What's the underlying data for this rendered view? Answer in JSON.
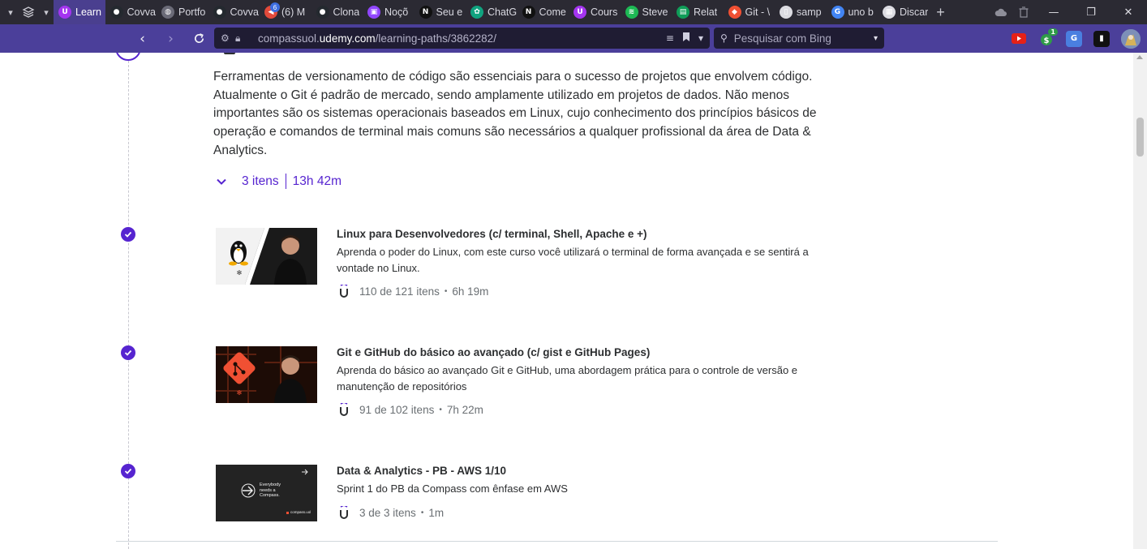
{
  "browser": {
    "tabs": [
      {
        "title": "Learn",
        "icon": "udemy-icon",
        "color": "#a435f0",
        "active": true
      },
      {
        "title": "Covva",
        "icon": "github-icon",
        "color": "#24292f"
      },
      {
        "title": "Portfo",
        "icon": "globe-icon",
        "color": "#6b6b78"
      },
      {
        "title": "Covva",
        "icon": "github-icon",
        "color": "#24292f"
      },
      {
        "title": "(6) M",
        "icon": "mail-icon",
        "color": "#e24a3b",
        "badge": "6"
      },
      {
        "title": "Clona",
        "icon": "github-icon",
        "color": "#24292f"
      },
      {
        "title": "Noçõ",
        "icon": "twitch-icon",
        "color": "#9146ff"
      },
      {
        "title": "Seu e",
        "icon": "notion-icon",
        "color": "#111111"
      },
      {
        "title": "ChatG",
        "icon": "openai-icon",
        "color": "#10a37f"
      },
      {
        "title": "Come",
        "icon": "notion-icon",
        "color": "#111111"
      },
      {
        "title": "Cours",
        "icon": "udemy-icon",
        "color": "#a435f0"
      },
      {
        "title": "Steve",
        "icon": "spotify-icon",
        "color": "#1db954"
      },
      {
        "title": "Relat",
        "icon": "sheets-icon",
        "color": "#0f9d58"
      },
      {
        "title": "Git - \\",
        "icon": "git-icon",
        "color": "#f05033"
      },
      {
        "title": "samp",
        "icon": "file-icon",
        "color": "#dcdce2"
      },
      {
        "title": "uno b",
        "icon": "google-icon",
        "color": "#4285f4"
      },
      {
        "title": "Discar",
        "icon": "grid-icon",
        "color": "#dcdce2"
      }
    ],
    "url_prefix": "compassuol.",
    "url_domain": "udemy.com",
    "url_path": "/learning-paths/3862282/",
    "search_placeholder": "Pesquisar com Bing",
    "extension_badge": "1"
  },
  "section": {
    "description": "Ferramentas de versionamento de código são essenciais para o sucesso de projetos que envolvem código. Atualmente o Git é padrão de mercado, sendo amplamente utilizado em projetos de dados. Não menos importantes são os sistemas operacionais baseados em Linux, cujo conhecimento dos princípios básicos de operação e comandos de terminal mais comuns são necessários a qualquer profissional da área de Data & Analytics.",
    "items_count": "3 itens",
    "duration": "13h 42m"
  },
  "courses": [
    {
      "title": "Linux para Desenvolvedores (c/ terminal, Shell, Apache e +)",
      "description": "Aprenda o poder do Linux, com este curso você utilizará o terminal de forma avançada e se sentirá a vontade no Linux.",
      "progress": "110 de 121 itens",
      "duration": "6h 19m",
      "completed": true
    },
    {
      "title": "Git e GitHub do básico ao avançado (c/ gist e GitHub Pages)",
      "description": "Aprenda do básico ao avançado Git e GitHub, uma abordagem prática para o controle de versão e manutenção de repositórios",
      "progress": "91 de 102 itens",
      "duration": "7h 22m",
      "completed": true
    },
    {
      "title": "Data & Analytics - PB - AWS 1/10",
      "description": "Sprint 1 do PB da Compass com ênfase em AWS",
      "progress": "3 de 3 itens",
      "duration": "1m",
      "completed": true,
      "thumbnail_text_1": "Everybody",
      "thumbnail_text_2": "needs a",
      "thumbnail_text_3": "Compass.",
      "thumbnail_brand": "compass.uol"
    }
  ],
  "colors": {
    "accent": "#5624d0",
    "text": "#2d2f31",
    "muted": "#6a6f73",
    "chrome_toolbar": "#4b3f9a",
    "chrome_tabbar": "#2b2a33"
  }
}
